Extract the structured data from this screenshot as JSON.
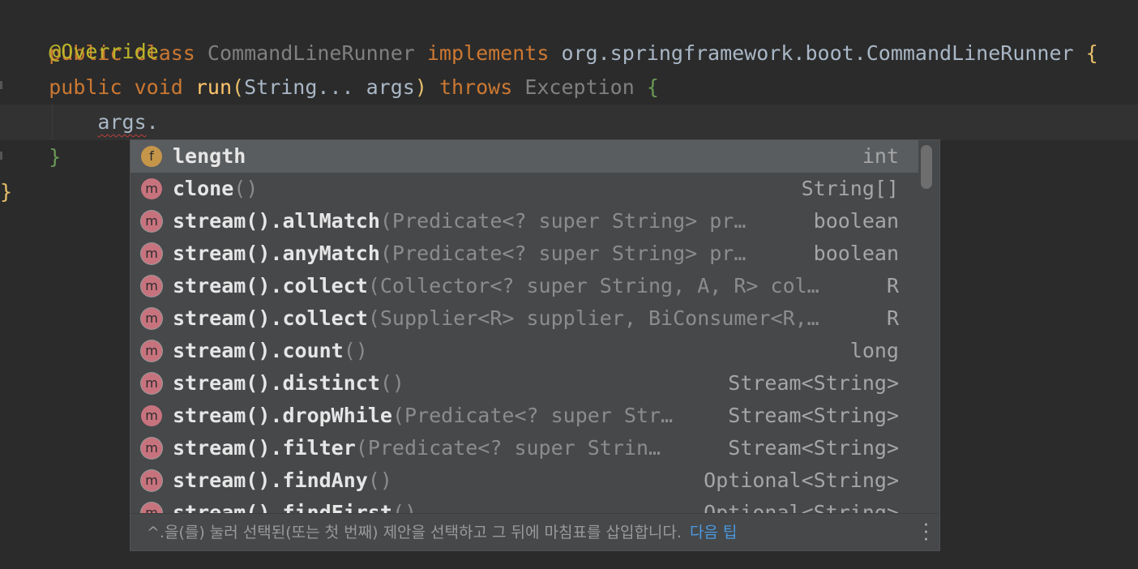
{
  "editor": {
    "line1": {
      "kw1": "public",
      "kw2": "class",
      "classname": "CommandLineRunner",
      "kw3": "implements",
      "iface": "org.springframework.boot.CommandLineRunner",
      "brace": "{"
    },
    "line2": {
      "annotation": "@Override"
    },
    "line3": {
      "kw1": "public",
      "kw2": "void",
      "method": "run",
      "open": "(",
      "params": "String... args",
      "close": ")",
      "kw3": "throws",
      "exc": "Exception",
      "brace": "{"
    },
    "line4": {
      "text": "args",
      "dot": "."
    },
    "line5": {
      "brace": "}"
    },
    "line6": {
      "brace": "}"
    }
  },
  "completion": {
    "items": [
      {
        "icon": "f",
        "main": "length",
        "params": "",
        "type": "int"
      },
      {
        "icon": "m",
        "main": "clone",
        "params": "()",
        "type": "String[]"
      },
      {
        "icon": "m",
        "main": "stream().allMatch",
        "params": "(Predicate<? super String> pr…",
        "type": "boolean"
      },
      {
        "icon": "m",
        "main": "stream().anyMatch",
        "params": "(Predicate<? super String> pr…",
        "type": "boolean"
      },
      {
        "icon": "m",
        "main": "stream().collect",
        "params": "(Collector<? super String, A, R> col…",
        "type": "R"
      },
      {
        "icon": "m",
        "main": "stream().collect",
        "params": "(Supplier<R> supplier, BiConsumer<R,…",
        "type": "R"
      },
      {
        "icon": "m",
        "main": "stream().count",
        "params": "()",
        "type": "long"
      },
      {
        "icon": "m",
        "main": "stream().distinct",
        "params": "()",
        "type": "Stream<String>"
      },
      {
        "icon": "m",
        "main": "stream().dropWhile",
        "params": "(Predicate<? super Str…",
        "type": "Stream<String>"
      },
      {
        "icon": "m",
        "main": "stream().filter",
        "params": "(Predicate<? super Strin…",
        "type": "Stream<String>"
      },
      {
        "icon": "m",
        "main": "stream().findAny",
        "params": "()",
        "type": "Optional<String>"
      },
      {
        "icon": "m",
        "main": "stream().findFirst",
        "params": "()",
        "type": "Optional<String>"
      }
    ],
    "footer": {
      "hint": "^.을(를) 눌러 선택된(또는 첫 번째) 제안을 선택하고 그 뒤에 마침표를 삽입합니다.",
      "next_tip": "다음 팁"
    }
  }
}
